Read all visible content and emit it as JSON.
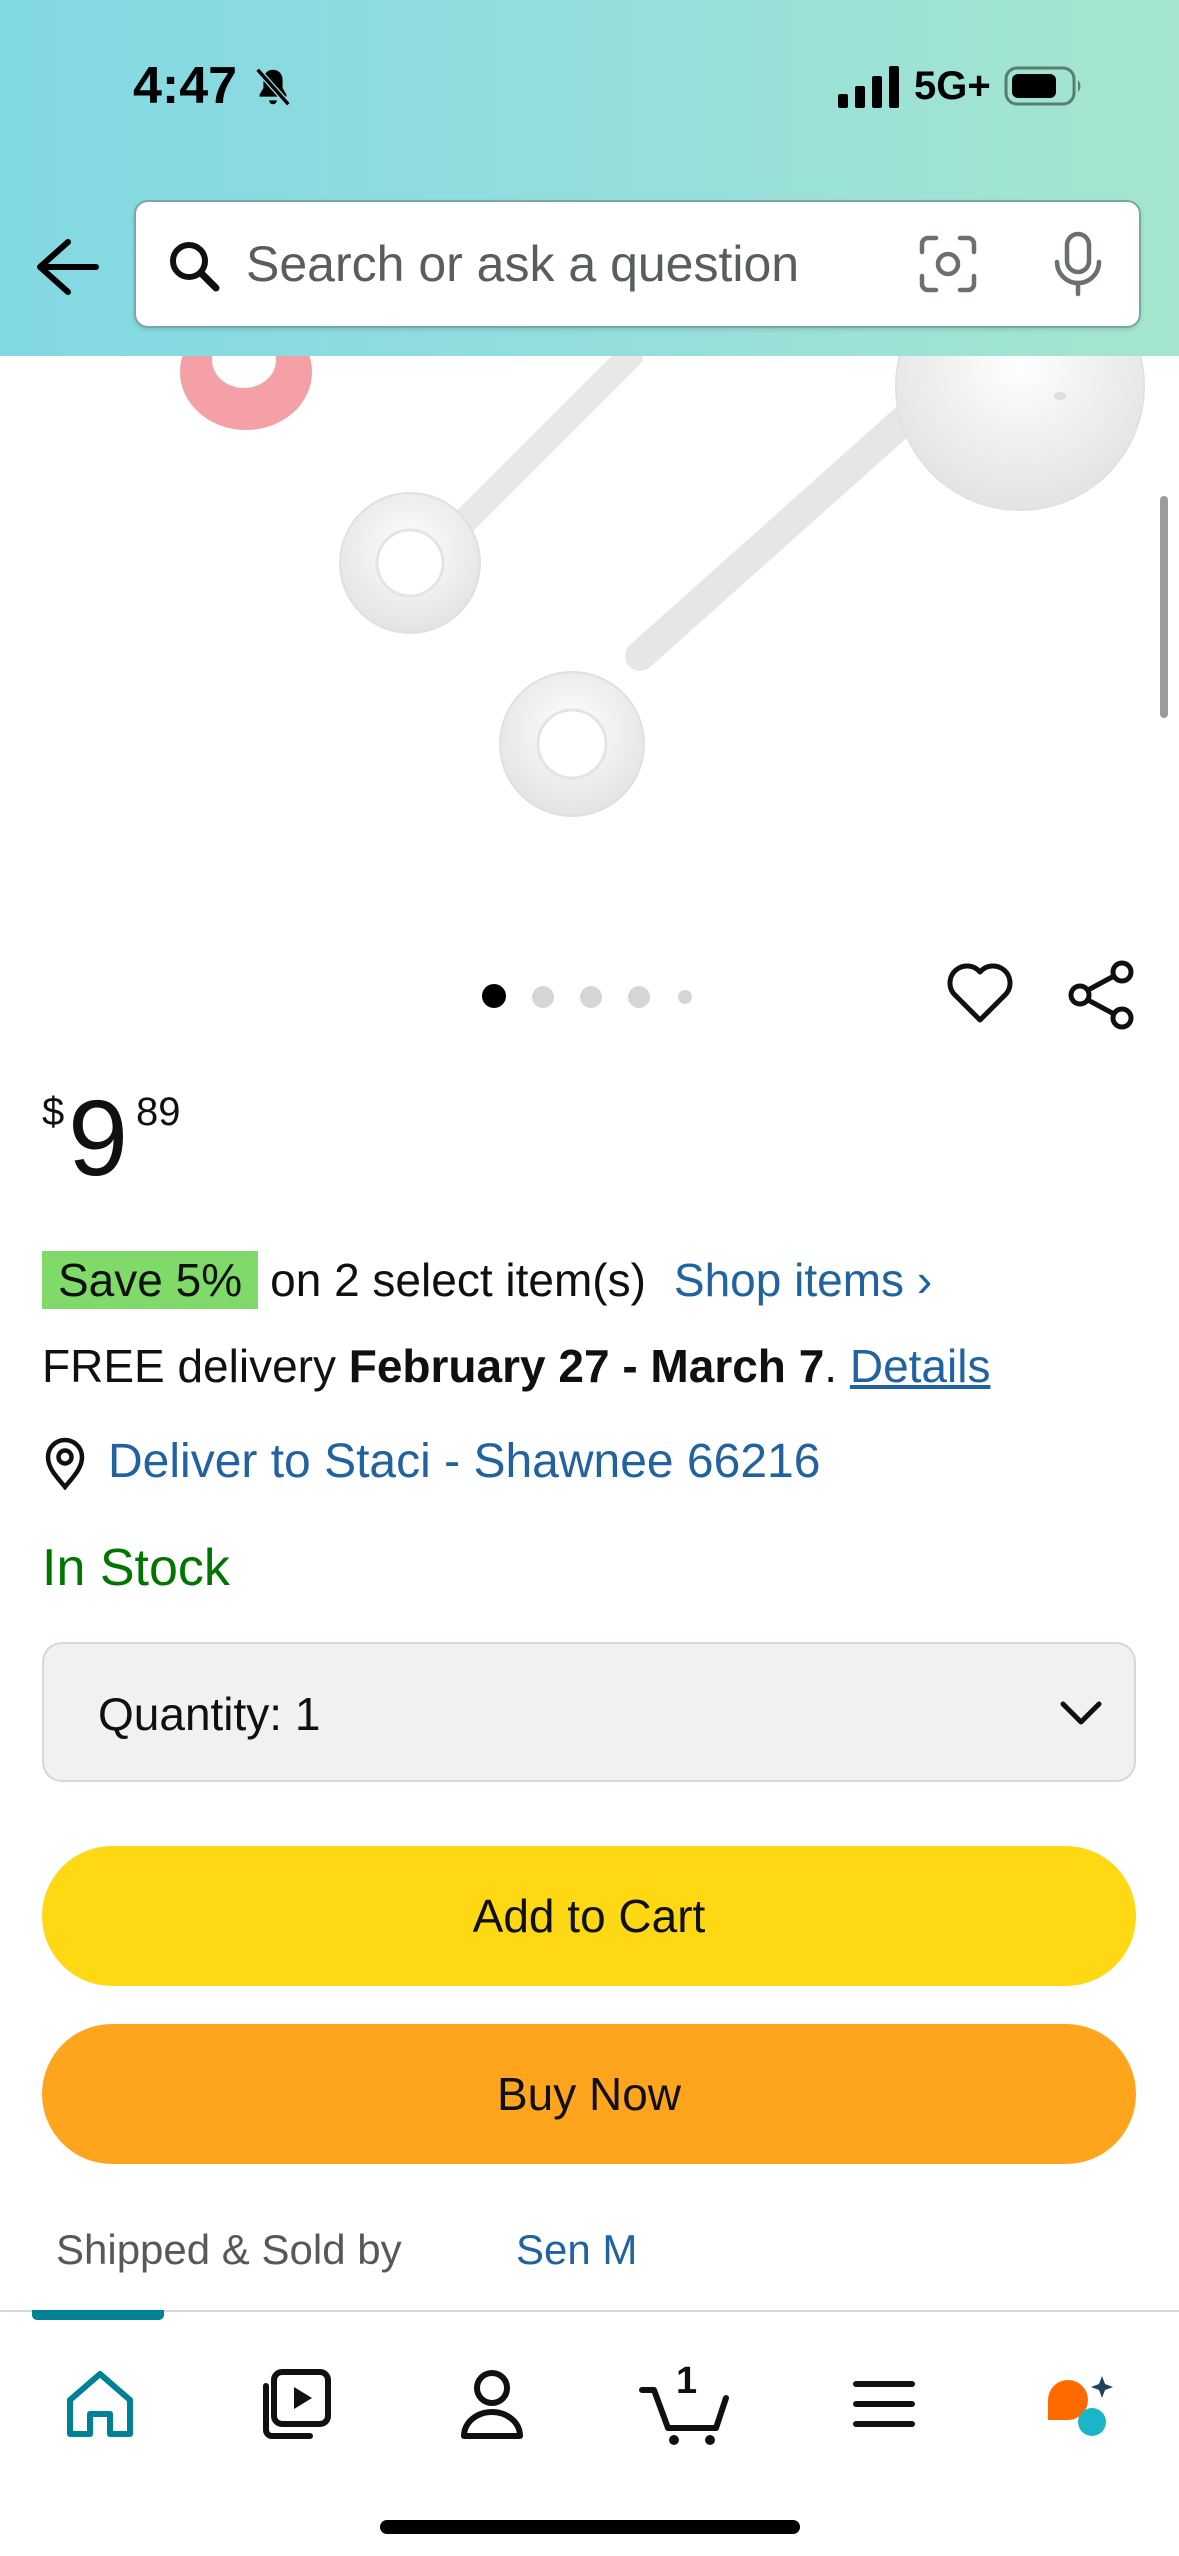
{
  "status_bar": {
    "time": "4:47",
    "network": "5G+",
    "icons": [
      "bell-off-icon",
      "signal-icon",
      "battery-icon"
    ]
  },
  "header": {
    "back_icon": "back-arrow-icon",
    "search_placeholder": "Search or ask a question",
    "icons": [
      "search-icon",
      "camera-icon",
      "mic-icon"
    ]
  },
  "product": {
    "image_dots": {
      "count": 5,
      "active_index": 0
    },
    "price": {
      "currency": "$",
      "whole": "9",
      "fraction": "89"
    },
    "promo": {
      "badge": "Save 5%",
      "text": "on 2 select item(s)",
      "link": "Shop items ›"
    },
    "delivery": {
      "prefix": "FREE delivery ",
      "dates": "February 27 - March 7",
      "suffix": ". ",
      "details_link": "Details"
    },
    "deliver_to": "Deliver to Staci - Shawnee 66216",
    "stock_status": "In Stock",
    "quantity_label": "Quantity:  1",
    "add_to_cart_label": "Add to Cart",
    "buy_now_label": "Buy Now",
    "shipped_sold_label": "Shipped & Sold by",
    "seller": "Sen M"
  },
  "bottom_nav": {
    "items": [
      "home-icon",
      "video-icon",
      "account-icon",
      "cart-icon",
      "menu-icon",
      "rufus-icon"
    ],
    "cart_count": "1",
    "active": "home-icon"
  },
  "colors": {
    "header_gradient_start": "#82d8e3",
    "header_gradient_end": "#a6e6ce",
    "link": "#2162a1",
    "in_stock": "#007600",
    "save_badge": "#7fda69",
    "add_to_cart": "#ffd814",
    "buy_now": "#ffa41c",
    "nav_active": "#008296"
  }
}
